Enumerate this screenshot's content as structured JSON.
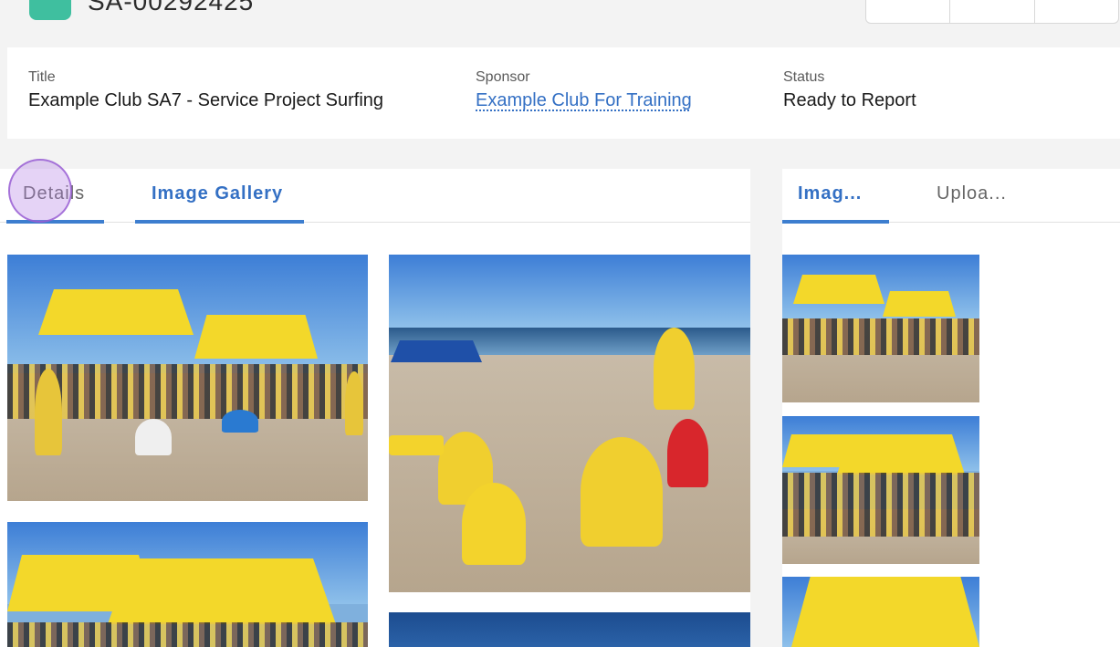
{
  "record": {
    "number": "SA-00292425"
  },
  "highlights": {
    "title_label": "Title",
    "title_value": "Example Club SA7 - Service Project Surfing",
    "sponsor_label": "Sponsor",
    "sponsor_value": "Example Club For Training",
    "status_label": "Status",
    "status_value": "Ready to Report"
  },
  "main_tabs": [
    {
      "label": "Details",
      "active": false
    },
    {
      "label": "Image Gallery",
      "active": true
    }
  ],
  "side_tabs": [
    {
      "label": "Imag...",
      "active": true
    },
    {
      "label": "Uploa...",
      "active": false
    }
  ],
  "colors": {
    "accent": "#3470c4",
    "record_icon": "#3fbf9f",
    "canopy_yellow": "#f3d82a"
  },
  "icons": {
    "record": "record-type-icon"
  }
}
